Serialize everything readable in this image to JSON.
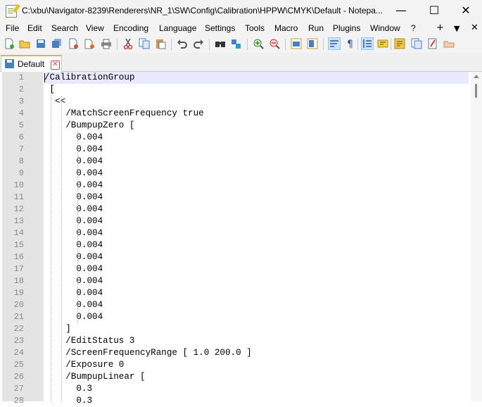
{
  "window": {
    "title": "C:\\xbu\\Navigator-8239\\Renderers\\NR_1\\SW\\Config\\Calibration\\HPPW\\CMYK\\Default - Notepa...",
    "minimize_glyph": "—",
    "maximize_glyph": "☐",
    "close_glyph": "✕"
  },
  "menu": {
    "items": [
      "File",
      "Edit",
      "Search",
      "View",
      "Encoding",
      "Language",
      "Settings",
      "Tools",
      "Macro",
      "Run",
      "Plugins",
      "Window",
      "?"
    ],
    "add_glyph": "+",
    "dropdown_glyph": "▼",
    "close_glyph": "✕"
  },
  "toolbar": {
    "icons": [
      "new-file-icon",
      "open-file-icon",
      "save-icon",
      "save-all-icon",
      "close-icon",
      "close-all-icon",
      "print-icon",
      "cut-icon",
      "copy-icon",
      "paste-icon",
      "undo-icon",
      "redo-icon",
      "find-icon",
      "replace-icon",
      "zoom-in-icon",
      "zoom-out-icon",
      "sync-vertical-icon",
      "sync-horizontal-icon",
      "word-wrap-icon",
      "show-all-chars-icon",
      "indent-guide-icon",
      "udl-icon",
      "doc-map-icon",
      "function-list-icon",
      "folder-workspace-icon",
      "monitoring-icon"
    ],
    "active_indexes": [
      18,
      20
    ]
  },
  "tab": {
    "label": "Default",
    "close_glyph": "✕"
  },
  "editor": {
    "current_line": 1,
    "lines": [
      {
        "n": "1",
        "text": "/CalibrationGroup"
      },
      {
        "n": "2",
        "text": " ["
      },
      {
        "n": "3",
        "text": "  <<"
      },
      {
        "n": "4",
        "text": "    /MatchScreenFrequency true"
      },
      {
        "n": "5",
        "text": "    /BumpupZero ["
      },
      {
        "n": "6",
        "text": "      0.004"
      },
      {
        "n": "7",
        "text": "      0.004"
      },
      {
        "n": "8",
        "text": "      0.004"
      },
      {
        "n": "9",
        "text": "      0.004"
      },
      {
        "n": "10",
        "text": "      0.004"
      },
      {
        "n": "11",
        "text": "      0.004"
      },
      {
        "n": "12",
        "text": "      0.004"
      },
      {
        "n": "13",
        "text": "      0.004"
      },
      {
        "n": "14",
        "text": "      0.004"
      },
      {
        "n": "15",
        "text": "      0.004"
      },
      {
        "n": "16",
        "text": "      0.004"
      },
      {
        "n": "17",
        "text": "      0.004"
      },
      {
        "n": "18",
        "text": "      0.004"
      },
      {
        "n": "19",
        "text": "      0.004"
      },
      {
        "n": "20",
        "text": "      0.004"
      },
      {
        "n": "21",
        "text": "      0.004"
      },
      {
        "n": "22",
        "text": "    ]"
      },
      {
        "n": "23",
        "text": "    /EditStatus 3"
      },
      {
        "n": "24",
        "text": "    /ScreenFrequencyRange [ 1.0 200.0 ]"
      },
      {
        "n": "25",
        "text": "    /Exposure 0"
      },
      {
        "n": "26",
        "text": "    /BumpupLinear ["
      },
      {
        "n": "27",
        "text": "      0.3"
      },
      {
        "n": "28",
        "text": "      0.3"
      }
    ]
  },
  "colors": {
    "titlebar_bg": "#f3f3f3",
    "gutter_bg": "#e4e4e4",
    "current_line_bg": "#e8e8ff",
    "tab_accent": "#f2a64a"
  }
}
